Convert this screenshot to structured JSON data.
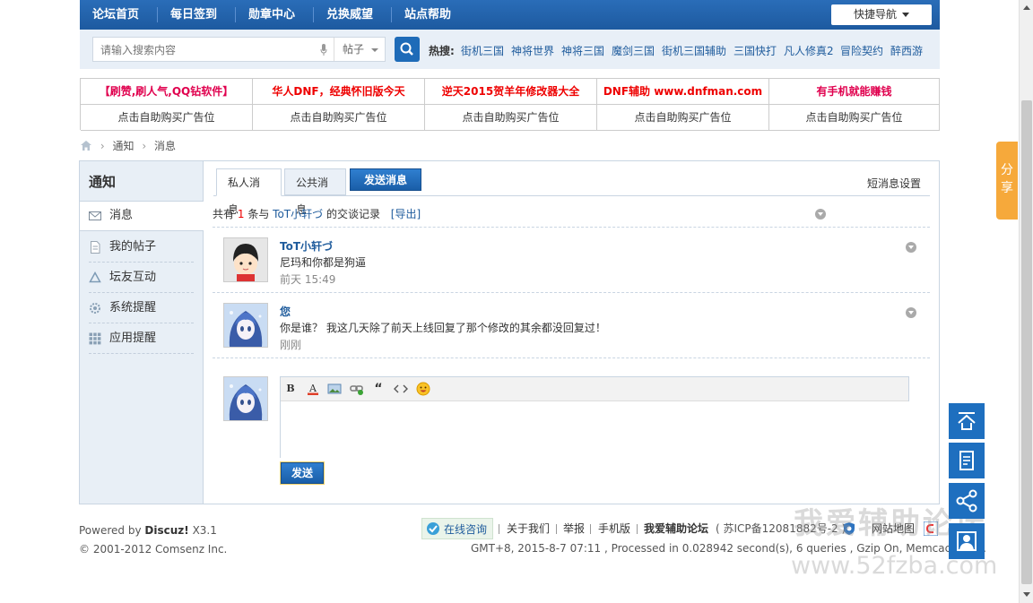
{
  "nav": {
    "items": [
      "论坛首页",
      "每日签到",
      "勋章中心",
      "兑换威望",
      "站点帮助"
    ],
    "quick_nav": "快捷导航"
  },
  "search": {
    "placeholder": "请输入搜索内容",
    "type": "帖子",
    "hot_label": "热搜:",
    "hot_keywords": [
      "街机三国",
      "神将世界",
      "神将三国",
      "魔剑三国",
      "街机三国辅助",
      "三国快打",
      "凡人修真2",
      "冒险契约",
      "醉西游"
    ]
  },
  "ads": {
    "row1": [
      "【刷赞,刷人气,QQ钻软件】",
      "华人DNF，经典怀旧版今天",
      "逆天2015贺羊年修改器大全",
      "DNF辅助 www.dnfman.com",
      "有手机就能赚钱"
    ],
    "row2": [
      "点击自助购买广告位",
      "点击自助购买广告位",
      "点击自助购买广告位",
      "点击自助购买广告位",
      "点击自助购买广告位"
    ]
  },
  "breadcrumb": [
    "通知",
    "消息"
  ],
  "sidebar": {
    "title": "通知",
    "items": [
      {
        "label": "消息",
        "icon": "envelope-icon"
      },
      {
        "label": "我的帖子",
        "icon": "document-icon"
      },
      {
        "label": "坛友互动",
        "icon": "recycle-icon"
      },
      {
        "label": "系统提醒",
        "icon": "gear-icon"
      },
      {
        "label": "应用提醒",
        "icon": "grid-icon"
      }
    ]
  },
  "tabs": {
    "private": "私人消息",
    "public": "公共消息",
    "send": "发送消息",
    "settings": "短消息设置"
  },
  "summary": {
    "prefix": "共有",
    "count": "1",
    "mid": "条与",
    "user": "ToT小轩づ",
    "suffix": "的交谈记录",
    "export": "[导出]"
  },
  "messages": [
    {
      "name": "ToT小轩づ",
      "text": "尼玛和你都是狗逼",
      "time": "前天 15:49"
    },
    {
      "name": "您",
      "text": "你是谁？ 我这几天除了前天上线回复了那个修改的其余都没回复过！",
      "time": "刚刚"
    }
  ],
  "editor": {
    "toolbar": [
      "bold-icon",
      "font-color-icon",
      "image-icon",
      "link-icon",
      "quote-icon",
      "code-icon",
      "smiley-icon"
    ],
    "send": "发送"
  },
  "footer": {
    "powered_prefix": "Powered by",
    "powered_name": "Discuz!",
    "powered_version": "X3.1",
    "copyright": "© 2001-2012 Comsenz Inc.",
    "online": "在线咨询",
    "links": [
      "关于我们",
      "举报",
      "手机版"
    ],
    "site_name": "我爱辅助论坛",
    "icp": "( 苏ICP备12081882号-2 )",
    "sitemap": "网站地图",
    "stats": "GMT+8, 2015-8-7 07:11 , Processed in 0.028942 second(s), 6 queries , Gzip On, Memcache On."
  },
  "share": "分享",
  "watermark": {
    "cn": "我爱辅助论坛",
    "url": "www.52fzba.com"
  }
}
